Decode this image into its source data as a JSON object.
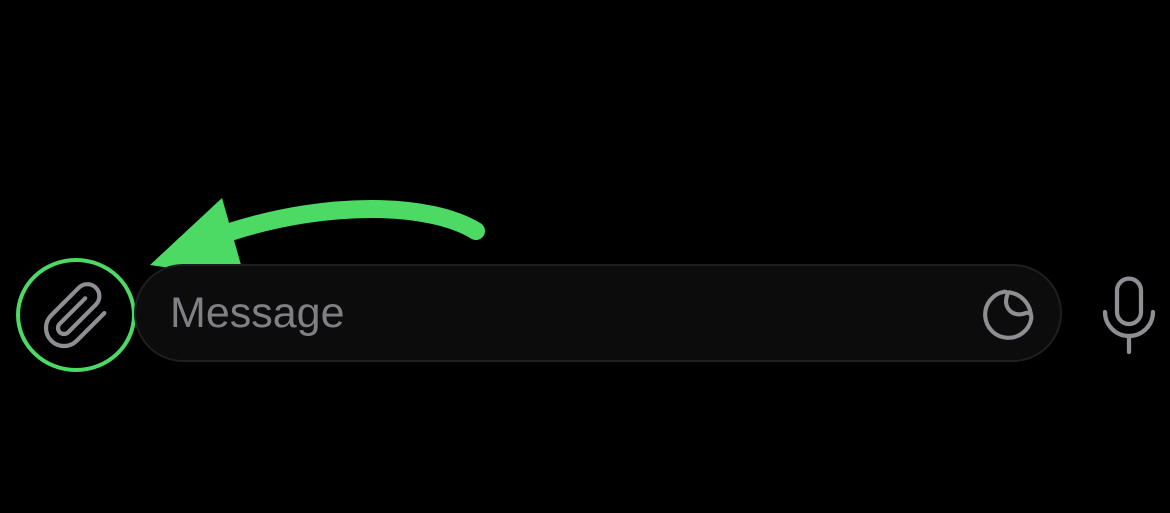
{
  "composer": {
    "attach_icon": "paperclip-icon",
    "message_placeholder": "Message",
    "message_value": "",
    "sticker_icon": "sticker-icon",
    "mic_icon": "microphone-icon"
  },
  "annotation": {
    "highlight_target": "attach-button",
    "highlight_color": "#4cd964",
    "arrow_color": "#4cd964"
  },
  "colors": {
    "background": "#000000",
    "icon_gray": "#8e8e93",
    "input_background": "#0c0c0c",
    "input_border": "#1f1f1f"
  }
}
